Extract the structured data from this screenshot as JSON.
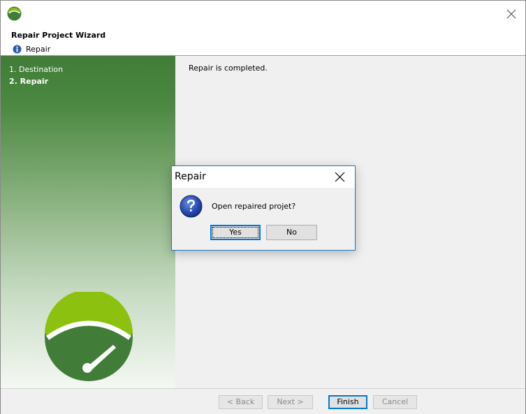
{
  "wizard": {
    "title": "Repair Project Wizard",
    "subtitle": "Repair"
  },
  "steps": [
    {
      "label": "1. Destination",
      "active": false
    },
    {
      "label": "2. Repair",
      "active": true
    }
  ],
  "content": {
    "message": "Repair is completed."
  },
  "footer": {
    "back_label": "< Back",
    "next_label": "Next >",
    "finish_label": "Finish",
    "cancel_label": "Cancel"
  },
  "dialog": {
    "title": "Repair",
    "message": "Open repaired projet?",
    "yes_label": "Yes",
    "no_label": "No",
    "icon": "question-icon"
  },
  "colors": {
    "brand_green": "#417d38",
    "brand_lime": "#8cc10f",
    "dialog_border": "#1a78c2",
    "focus_blue": "#0078d7"
  }
}
